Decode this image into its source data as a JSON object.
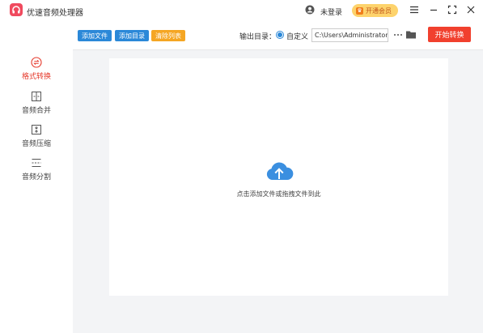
{
  "app": {
    "title": "优速音频处理器",
    "logo_icon": "headphones-icon"
  },
  "header": {
    "login_text": "未登录",
    "vip_label": "开通会员",
    "vip_icon": "crown-icon"
  },
  "toolbar": {
    "add_file": "添加文件",
    "add_folder": "添加目录",
    "clear_list": "清除列表",
    "output_label": "输出目录：",
    "custom_label": "自定义",
    "output_path": "C:\\Users\\Administrator\\",
    "start_label": "开始转换"
  },
  "sidebar": {
    "items": [
      {
        "label": "格式转换",
        "icon": "convert-icon",
        "active": true
      },
      {
        "label": "音频合并",
        "icon": "merge-icon",
        "active": false
      },
      {
        "label": "音频压缩",
        "icon": "compress-icon",
        "active": false
      },
      {
        "label": "音频分割",
        "icon": "split-icon",
        "active": false
      }
    ]
  },
  "main": {
    "drop_hint": "点击添加文件或拖拽文件到此",
    "upload_icon": "cloud-upload-icon"
  },
  "colors": {
    "accent_blue": "#2b88d8",
    "accent_orange": "#f5a623",
    "start_red": "#f1402e",
    "active_red": "#e5392b",
    "vip_yellow": "#fdd36c"
  }
}
